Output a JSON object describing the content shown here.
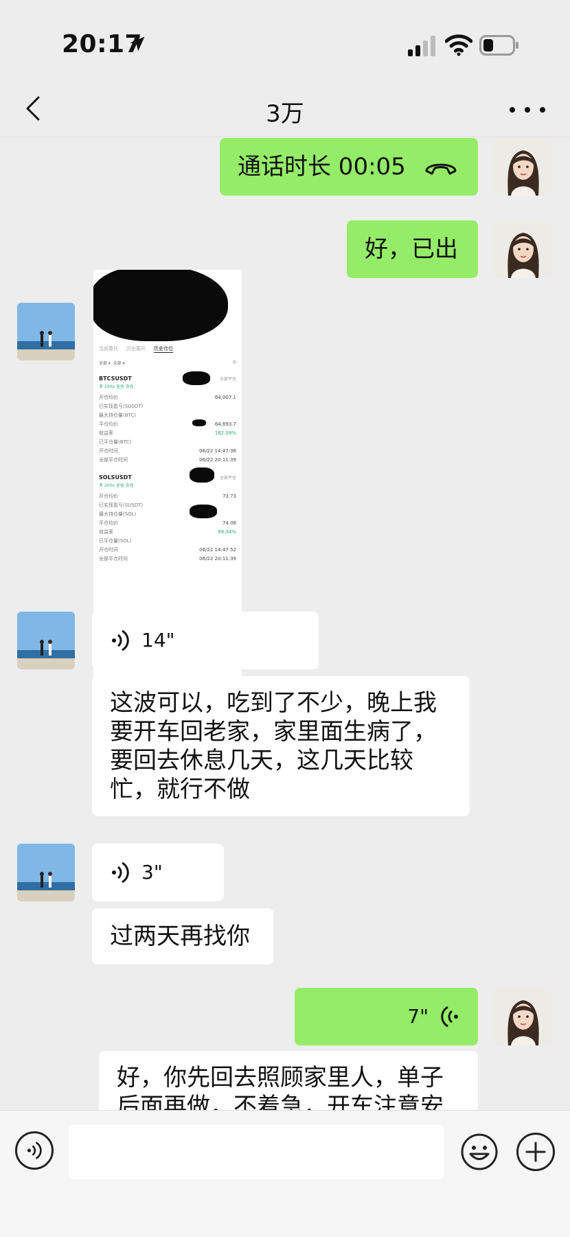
{
  "status_bar": {
    "time": "20:17"
  },
  "nav": {
    "title": "3万"
  },
  "messages": {
    "call": {
      "text": "通话时长 00:05"
    },
    "reply1": {
      "text": "好，已出"
    },
    "voice1": {
      "duration": "14\""
    },
    "text1": {
      "text": "这波可以，吃到了不少，晚上我要开车回老家，家里面生病了，要回去休息几天，这几天比较忙，就行不做"
    },
    "voice2": {
      "duration": "3\""
    },
    "text2": {
      "text": "过两天再找你"
    },
    "voice3": {
      "duration": "7\""
    },
    "text3": {
      "text": "好，你先回去照顾家里人，单子后面再做，不着急，开车注意安"
    }
  },
  "screenshot": {
    "tabs": [
      "当前委托",
      "历史委托",
      "历史仓位"
    ],
    "filters": [
      "全部 ▾",
      "全部 ▾"
    ],
    "positions": [
      {
        "symbol": "BTCSUSDT",
        "action": "全部平仓",
        "tag": "多 200x  全仓  合仓",
        "rows": [
          {
            "k": "开仓均价",
            "v": "64,007.1"
          },
          {
            "k": "已实现盈亏(SUSDT)",
            "v": ""
          },
          {
            "k": "最大持仓量(BTC)",
            "v": ""
          },
          {
            "k": "平仓均价",
            "v": "64,693.7"
          },
          {
            "k": "收益率",
            "v": "182.09%"
          },
          {
            "k": "已平仓量(BTC)",
            "v": ""
          },
          {
            "k": "开仓时间",
            "v": "06/22 14:47:36"
          },
          {
            "k": "全部平仓时间",
            "v": "06/22 20:11:39"
          }
        ]
      },
      {
        "symbol": "SOLSUSDT",
        "action": "全部平仓",
        "tag": "多 200x  全仓  合仓",
        "rows": [
          {
            "k": "开仓均价",
            "v": "73.73"
          },
          {
            "k": "已实现盈亏(SUSDT)",
            "v": ""
          },
          {
            "k": "最大持仓量(SOL)",
            "v": ""
          },
          {
            "k": "平仓均价",
            "v": "74.06"
          },
          {
            "k": "收益率",
            "v": "89.34%"
          },
          {
            "k": "已平仓量(SOL)",
            "v": ""
          },
          {
            "k": "开仓时间",
            "v": "06/22 14:47:52"
          },
          {
            "k": "全部平仓时间",
            "v": "06/22 20:11:39"
          }
        ]
      }
    ]
  },
  "input": {
    "placeholder": ""
  },
  "colors": {
    "right_bubble": "#95ec69",
    "left_bubble": "#ffffff",
    "background": "#ededed"
  }
}
